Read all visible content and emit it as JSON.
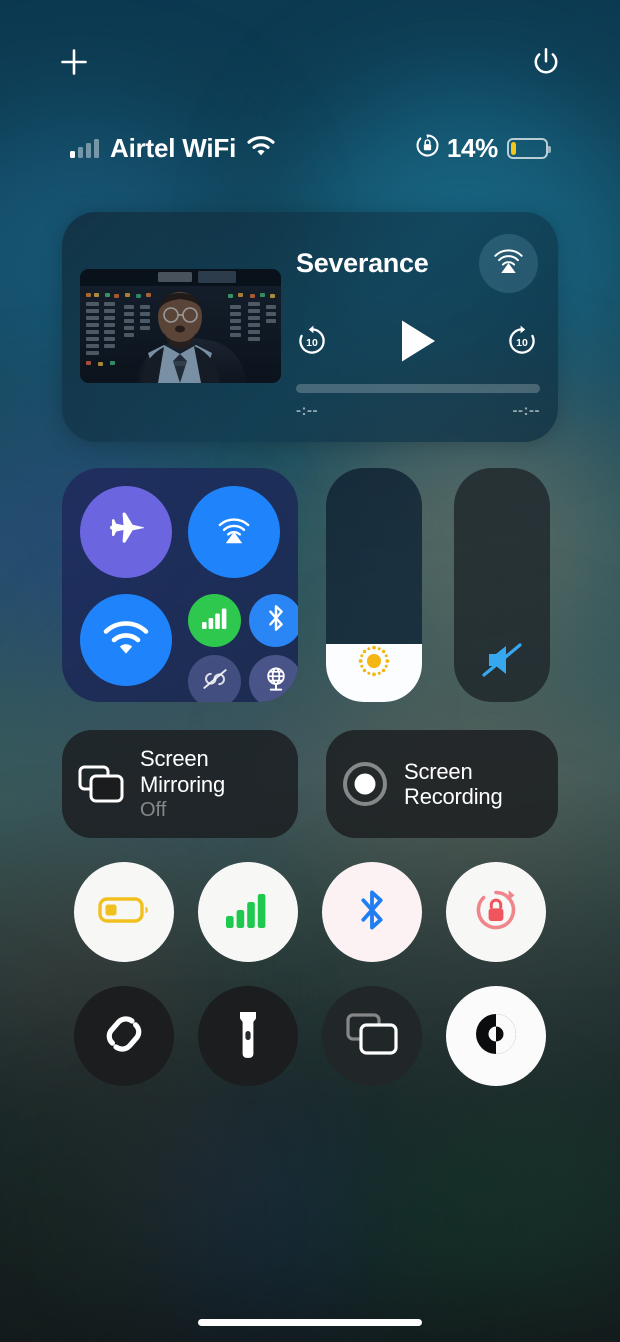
{
  "statusbar": {
    "carrier": "Airtel WiFi",
    "battery_percent_label": "14%",
    "battery_level": 14,
    "signal_bars_filled": 1,
    "signal_bars_total": 4,
    "wifi_icon": "wifi-icon",
    "rotation_lock_icon": "rotation-lock-icon",
    "battery_color": "#f5c518"
  },
  "topbar": {
    "add_label": "+",
    "add_icon": "plus-icon",
    "power_icon": "power-icon"
  },
  "media": {
    "title": "Severance",
    "airplay_icon": "airplay-icon",
    "skip_back_label": "10",
    "skip_forward_label": "10",
    "skip_back_icon": "skip-back-10-icon",
    "play_icon": "play-icon",
    "skip_forward_icon": "skip-forward-10-icon",
    "progress_percent": 0,
    "time_elapsed": "-:--",
    "time_remaining": "--:--",
    "artwork_alt": "severance-thumbnail"
  },
  "connectivity": {
    "airplane": {
      "name": "airplane-mode",
      "icon": "airplane-icon",
      "state": "on",
      "color": "#6b66e0"
    },
    "airdrop": {
      "name": "airdrop",
      "icon": "airdrop-icon",
      "state": "on",
      "color": "#1f84fb"
    },
    "wifi": {
      "name": "wifi",
      "icon": "wifi-icon",
      "state": "on",
      "color": "#1f84fb"
    },
    "cellular": {
      "name": "cellular-data",
      "icon": "cellular-bars-icon",
      "state": "on",
      "color": "#2ec84f"
    },
    "bluetooth": {
      "name": "bluetooth",
      "icon": "bluetooth-icon",
      "state": "on",
      "color": "#2a86f5"
    },
    "hotspot": {
      "name": "personal-hotspot",
      "icon": "hotspot-off-icon",
      "state": "off"
    },
    "vpn": {
      "name": "vpn",
      "icon": "globe-vpn-icon",
      "state": "off"
    }
  },
  "sliders": {
    "brightness": {
      "label": "Brightness",
      "icon": "brightness-sun-icon",
      "value": 25
    },
    "volume": {
      "label": "Volume",
      "icon": "volume-muted-icon",
      "value": 0,
      "muted": true
    }
  },
  "tiles": [
    {
      "name": "screen-mirroring",
      "label": "Screen Mirroring",
      "status": "Off",
      "icon": "screen-mirroring-icon"
    },
    {
      "name": "screen-recording",
      "label": "Screen Recording",
      "status": "",
      "icon": "record-circle-icon"
    }
  ],
  "controls": [
    {
      "name": "low-power-mode",
      "icon": "low-battery-icon",
      "style": "light",
      "active": true,
      "accent": "#f5c518"
    },
    {
      "name": "cellular-data-toggle",
      "icon": "cellular-bars-icon",
      "style": "light",
      "active": true,
      "accent": "#2ec84f"
    },
    {
      "name": "bluetooth-toggle",
      "icon": "bluetooth-icon",
      "style": "pinkish",
      "active": true,
      "accent": "#2a7ef0"
    },
    {
      "name": "rotation-lock-toggle",
      "icon": "rotation-lock-icon",
      "style": "light",
      "active": true,
      "accent": "#f0545c"
    },
    {
      "name": "shazam",
      "icon": "shazam-icon",
      "style": "dark",
      "active": false,
      "accent": "#ffffff"
    },
    {
      "name": "flashlight",
      "icon": "flashlight-icon",
      "style": "dark",
      "active": false,
      "accent": "#ffffff"
    },
    {
      "name": "screen-mirroring-toggle",
      "icon": "screen-mirroring-icon",
      "style": "darkish",
      "active": false,
      "accent": "#ffffff"
    },
    {
      "name": "dark-mode-toggle",
      "icon": "contrast-circle-icon",
      "style": "white",
      "active": true,
      "accent": "#0b0c0d"
    }
  ],
  "home_indicator": {
    "name": "home-indicator"
  }
}
